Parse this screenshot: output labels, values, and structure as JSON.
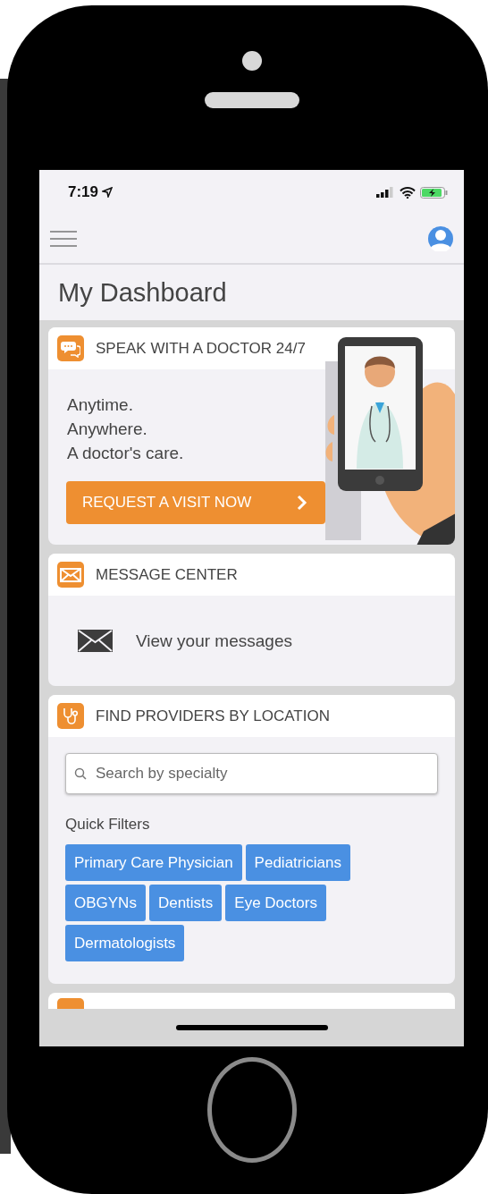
{
  "status_bar": {
    "time": "7:19"
  },
  "page_title": "My Dashboard",
  "doctor_card": {
    "title": "SPEAK WITH A DOCTOR 24/7",
    "taglines": [
      "Anytime.",
      "Anywhere.",
      "A doctor's care."
    ],
    "button": "REQUEST A VISIT NOW"
  },
  "message_card": {
    "title": "MESSAGE CENTER",
    "link": "View your messages"
  },
  "provider_card": {
    "title": "FIND PROVIDERS BY LOCATION",
    "search": {
      "placeholder": "Search by specialty"
    },
    "filters_label": "Quick Filters",
    "filters": [
      "Primary Care Physician",
      "Pediatricians",
      "OBGYNs",
      "Dentists",
      "Eye Doctors",
      "Dermatologists"
    ]
  }
}
